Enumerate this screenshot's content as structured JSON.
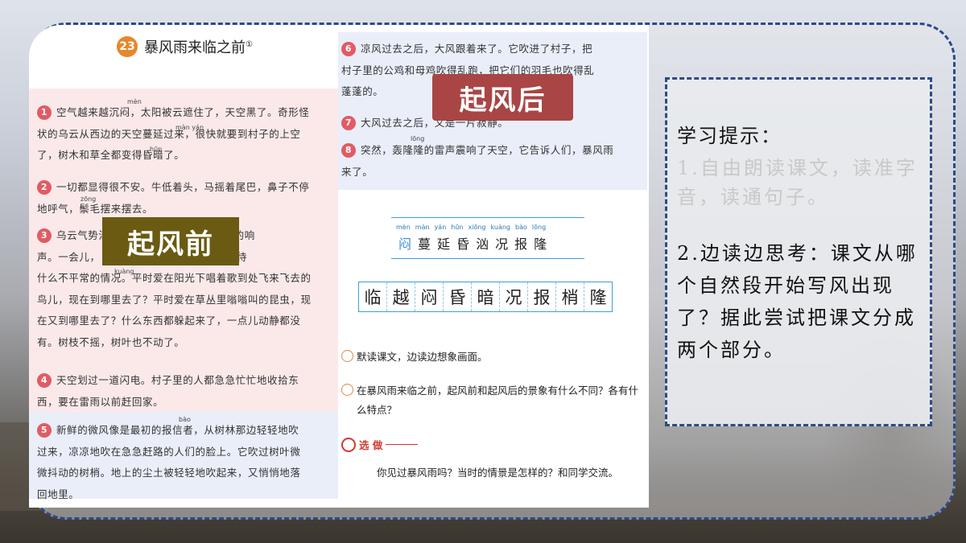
{
  "lesson": {
    "number": "23",
    "title": "暴风雨来临之前",
    "footnote_mark": "①"
  },
  "labels": {
    "before_wind": "起风前",
    "after_wind": "起风后"
  },
  "paragraphs_left": [
    {
      "num": "1",
      "lines": [
        "空气越来越沉闷，太阳被云遮住了，天空黑了。奇形怪",
        "状的乌云从西边的天空蔓延过来，很快就要到村子的上空",
        "了，树木和草全都变得昏暗了。"
      ]
    },
    {
      "num": "2",
      "lines": [
        "一切都显得很不安。牛低着头，马摇着尾巴，鼻子不停",
        "地呼气，鬃毛摆来摆去。"
      ]
    },
    {
      "num": "3",
      "lines": [
        "乌云气势汹汹，           方发出了轻微的响",
        "声。一会儿，                 下来，好像在等待",
        "什么不平常的情况。平时爱在阳光下唱着歌到处飞来飞去的",
        "鸟儿，现在到哪里去了？平时爱在草丛里嗡嗡叫的昆虫，现",
        "在又到哪里去了？什么东西都躲起来了，一点儿动静都没",
        "有。树枝不摇，树叶也不动了。"
      ]
    },
    {
      "num": "4",
      "lines": [
        "天空划过一道闪电。村子里的人都急急忙忙地收拾东",
        "西，要在雷雨以前赶回家。"
      ]
    },
    {
      "num": "5",
      "lines": [
        "新鲜的微风像是最初的报信者，从树林那边轻轻地吹",
        "过来，凉凉地吹在急急赶路的人们的脸上。它吹过树叶微",
        "微抖动的树梢。地上的尘土被轻轻地吹起来，又悄悄地落",
        "回地里。"
      ]
    }
  ],
  "pinyin_left": {
    "men": "mèn",
    "manyan": "màn yán",
    "hun": "hūn",
    "zong": "zōng",
    "kuang": "kuàng",
    "bao": "bào"
  },
  "paragraphs_right": [
    {
      "num": "6",
      "lines": [
        "凉风过去之后，大风跟着来了。它吹进了村子，把",
        "村子里的公鸡和母鸡吹得乱跑，把它们的羽毛也吹得乱",
        "蓬蓬的。"
      ]
    },
    {
      "num": "7",
      "lines": [
        "大风过去之后，又是一片寂静。"
      ]
    },
    {
      "num": "8",
      "lines": [
        "突然，轰隆隆的雷声震响了天空，它告诉人们，暴风雨",
        "来了。"
      ]
    }
  ],
  "pinyin_right": {
    "long": "lōng"
  },
  "char_list": {
    "pinyin": [
      "mèn",
      "màn",
      "yán",
      "hūn",
      "xiōng",
      "kuàng",
      "bào",
      "lōng"
    ],
    "chars": [
      "闷",
      "蔓",
      "延",
      "昏",
      "汹",
      "况",
      "报",
      "隆"
    ]
  },
  "write_chars": [
    "临",
    "越",
    "闷",
    "昏",
    "暗",
    "况",
    "报",
    "梢",
    "隆"
  ],
  "tasks": [
    "默读课文，边读边想象画面。",
    "在暴风雨来临之前，起风前和起风后的景象有什么不同？各有什",
    "么特点？"
  ],
  "xuanzuo": {
    "label": "选 做",
    "text": "你见过暴风雨吗？当时的情景是怎样的？和同学交流。"
  },
  "hint": {
    "title": "学习提示：",
    "item1": "1.自由朗读课文，读准字音，读通句子。",
    "item2": "2.边读边思考：课文从哪个自然段开始写风出现了？据此尝试把课文分成两个部分。"
  }
}
